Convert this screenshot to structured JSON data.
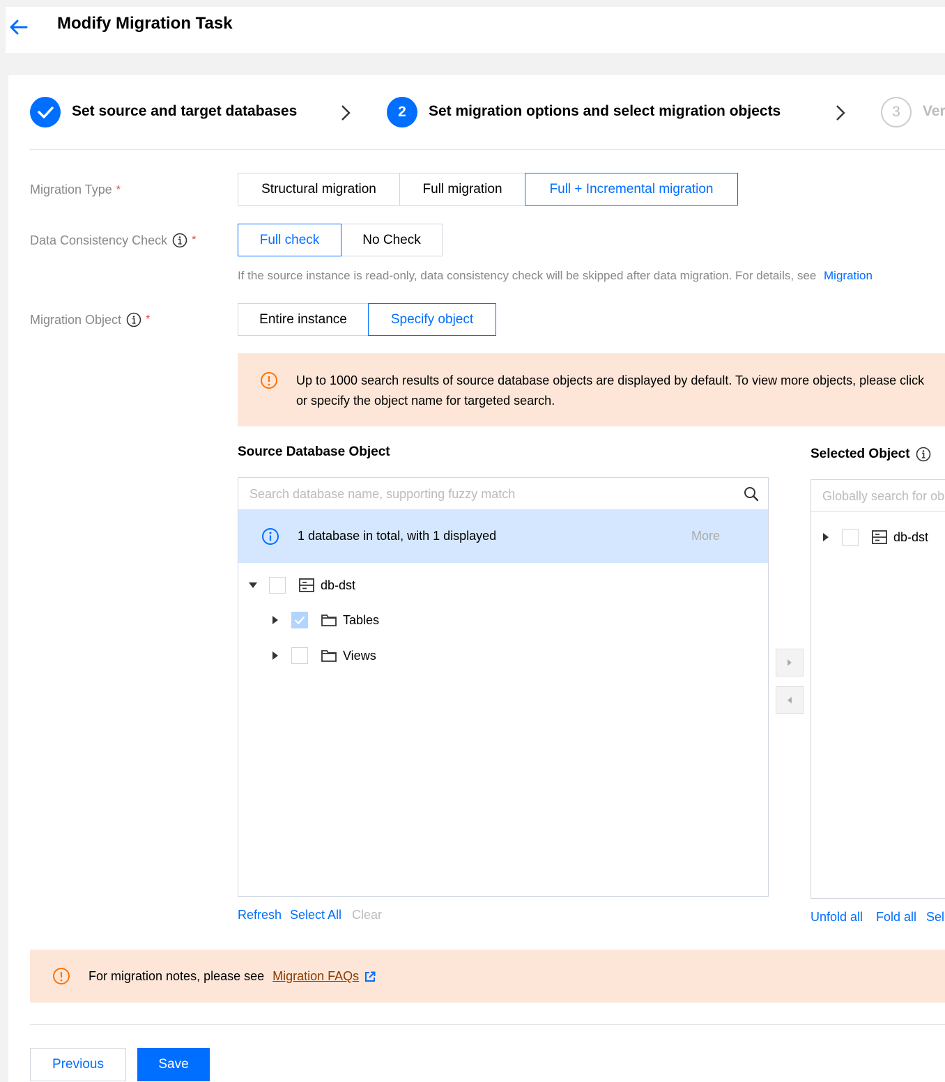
{
  "header": {
    "title": "Modify Migration Task",
    "back_icon": "arrow-left-icon"
  },
  "steps": [
    {
      "label": "Set source and target databases",
      "state": "done"
    },
    {
      "number": "2",
      "label": "Set migration options and select migration objects",
      "state": "current"
    },
    {
      "number": "3",
      "label": "Ver",
      "state": "pending"
    }
  ],
  "form": {
    "migration_type": {
      "label": "Migration Type",
      "required": "*",
      "options": [
        "Structural migration",
        "Full migration",
        "Full + Incremental migration"
      ],
      "selected": "Full + Incremental migration"
    },
    "consistency_check": {
      "label": "Data Consistency Check",
      "required": "*",
      "options": [
        "Full check",
        "No Check"
      ],
      "selected": "Full check",
      "hint": "If the source instance is read-only, data consistency check will be skipped after data migration. For details, see",
      "hint_link": "Migration"
    },
    "migration_object": {
      "label": "Migration Object",
      "required": "*",
      "options": [
        "Entire instance",
        "Specify object"
      ],
      "selected": "Specify object"
    }
  },
  "object_warning": {
    "line1": "Up to 1000 search results of source database objects are displayed by default. To view more objects, please click",
    "line2": "or specify the object name for targeted search."
  },
  "source": {
    "title": "Source Database Object",
    "search_placeholder": "Search database name, supporting fuzzy match",
    "info": "1 database in total, with 1 displayed",
    "more": "More",
    "tree": [
      {
        "label": "db-dst",
        "expanded": true,
        "checked": false,
        "level": 0,
        "icon": "database-icon"
      },
      {
        "label": "Tables",
        "expanded": false,
        "checked": true,
        "level": 1,
        "icon": "folder-icon"
      },
      {
        "label": "Views",
        "expanded": false,
        "checked": false,
        "level": 1,
        "icon": "folder-icon"
      }
    ],
    "actions": {
      "refresh": "Refresh",
      "select_all": "Select All",
      "clear": "Clear"
    }
  },
  "selected": {
    "title": "Selected Object",
    "search_placeholder": "Globally search for objects",
    "tree": [
      {
        "label": "db-dst",
        "expanded": false,
        "checked": false,
        "icon": "database-icon"
      }
    ],
    "actions": {
      "unfold_all": "Unfold all",
      "fold_all": "Fold all",
      "select": "Sel"
    }
  },
  "notes": {
    "text": "For migration notes, please see",
    "link": "Migration FAQs"
  },
  "footer": {
    "previous": "Previous",
    "save": "Save"
  },
  "colors": {
    "primary": "#006eff",
    "warning_bg": "#fde6d8",
    "warning_icon": "#ff7200",
    "info_bg": "#d5e7ff",
    "required": "#e54545"
  }
}
